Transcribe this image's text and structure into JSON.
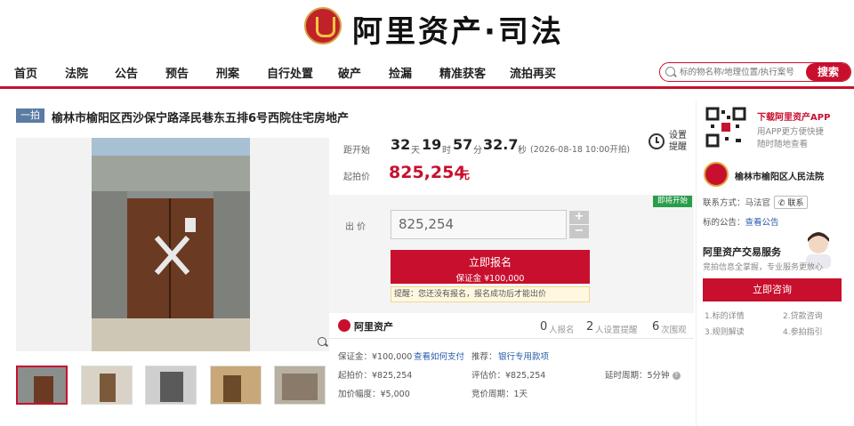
{
  "header": {
    "brand": "阿里资产·司法"
  },
  "nav": {
    "items": [
      "首页",
      "法院",
      "公告",
      "预告",
      "刑案",
      "自行处置",
      "破产",
      "捡漏",
      "精准获客",
      "流拍再买"
    ]
  },
  "search": {
    "placeholder": "标的物名称/地理位置/执行案号",
    "button": "搜索"
  },
  "listing": {
    "badge": "一拍",
    "title": "榆林市榆阳区西沙保宁路泽民巷东五排6号西院住宅房地产"
  },
  "countdown": {
    "label": "距开始",
    "days": "32",
    "days_unit": "天",
    "hours": "19",
    "hours_unit": "时",
    "minutes": "57",
    "minutes_unit": "分",
    "seconds": "32.7",
    "seconds_unit": "秒",
    "start_note": "(2026-08-18 10:00开拍)"
  },
  "reminder": {
    "label": "设置提醒"
  },
  "start_price": {
    "label": "起拍价",
    "value": "825,254",
    "unit": "元"
  },
  "bid": {
    "status_tag": "即将开始",
    "label": "出 价",
    "value": "825,254",
    "plus": "+",
    "minus": "−",
    "register": "立即报名",
    "deposit": "保证金 ¥100,000",
    "tip": "提醒：您还没有报名，报名成功后才能出价"
  },
  "stats": {
    "brand": "阿里资产",
    "signups": "0",
    "signups_label": "人报名",
    "reminders": "2",
    "reminders_label": "人设置提醒",
    "views": "6",
    "views_label": "次围观"
  },
  "details": {
    "deposit": "保证金：¥100,000",
    "how_to_pay": "查看如何支付",
    "recommend": "推荐：",
    "bank_link": "银行专用款项",
    "start_price": "起拍价：¥825,254",
    "appraisal": "评估价：¥825,254",
    "delay": "延时周期：5分钟",
    "increment": "加价幅度：¥5,000",
    "period": "竞价周期：1天"
  },
  "app": {
    "title": "下载阿里资产APP",
    "line1": "用APP更方便快捷",
    "line2": "随时随地查看"
  },
  "court": {
    "name": "榆林市榆阳区人民法院",
    "contact_label": "联系方式：",
    "contact_person": "马法官",
    "contact_btn": "联系",
    "notice_label": "标的公告：",
    "notice_link": "查看公告"
  },
  "service": {
    "title": "阿里资产交易服务",
    "subtitle": "竞拍信息全掌握，专业服务更放心",
    "consult": "立即咨询",
    "links": [
      "1.标的详情",
      "2.贷款咨询",
      "3.规则解读",
      "4.参拍指引"
    ]
  },
  "colors": {
    "brand": "#c8102e",
    "start_tag": "#2a9d4b",
    "badge": "#5b7ba3"
  }
}
